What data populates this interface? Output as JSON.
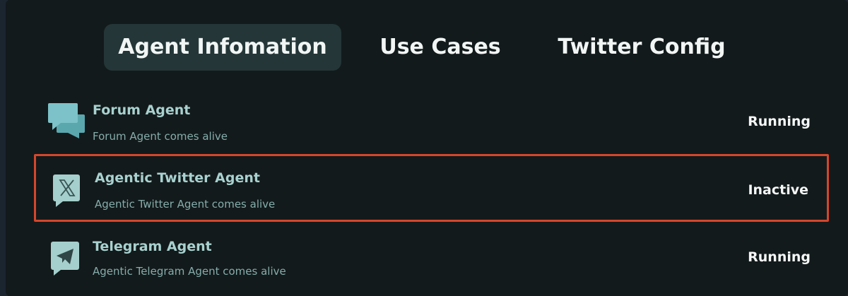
{
  "tabs": [
    {
      "label": "Agent Infomation",
      "active": true
    },
    {
      "label": "Use Cases",
      "active": false
    },
    {
      "label": "Twitter Config",
      "active": false
    }
  ],
  "agents": [
    {
      "title": "Forum Agent",
      "subtitle": "Forum Agent comes alive",
      "status": "Running",
      "icon": "chat-bubbles-icon"
    },
    {
      "title": "Agentic Twitter Agent",
      "subtitle": "Agentic Twitter Agent comes alive",
      "status": "Inactive",
      "icon": "x-logo-icon",
      "selected": true
    },
    {
      "title": "Telegram Agent",
      "subtitle": "Agentic Telegram Agent comes alive",
      "status": "Running",
      "icon": "telegram-icon"
    }
  ],
  "colors": {
    "background": "#131a1b",
    "tab_active_bg": "#243638",
    "icon": "#79bfc4",
    "title": "#a8d1cf",
    "highlight_border": "#d5462c"
  }
}
